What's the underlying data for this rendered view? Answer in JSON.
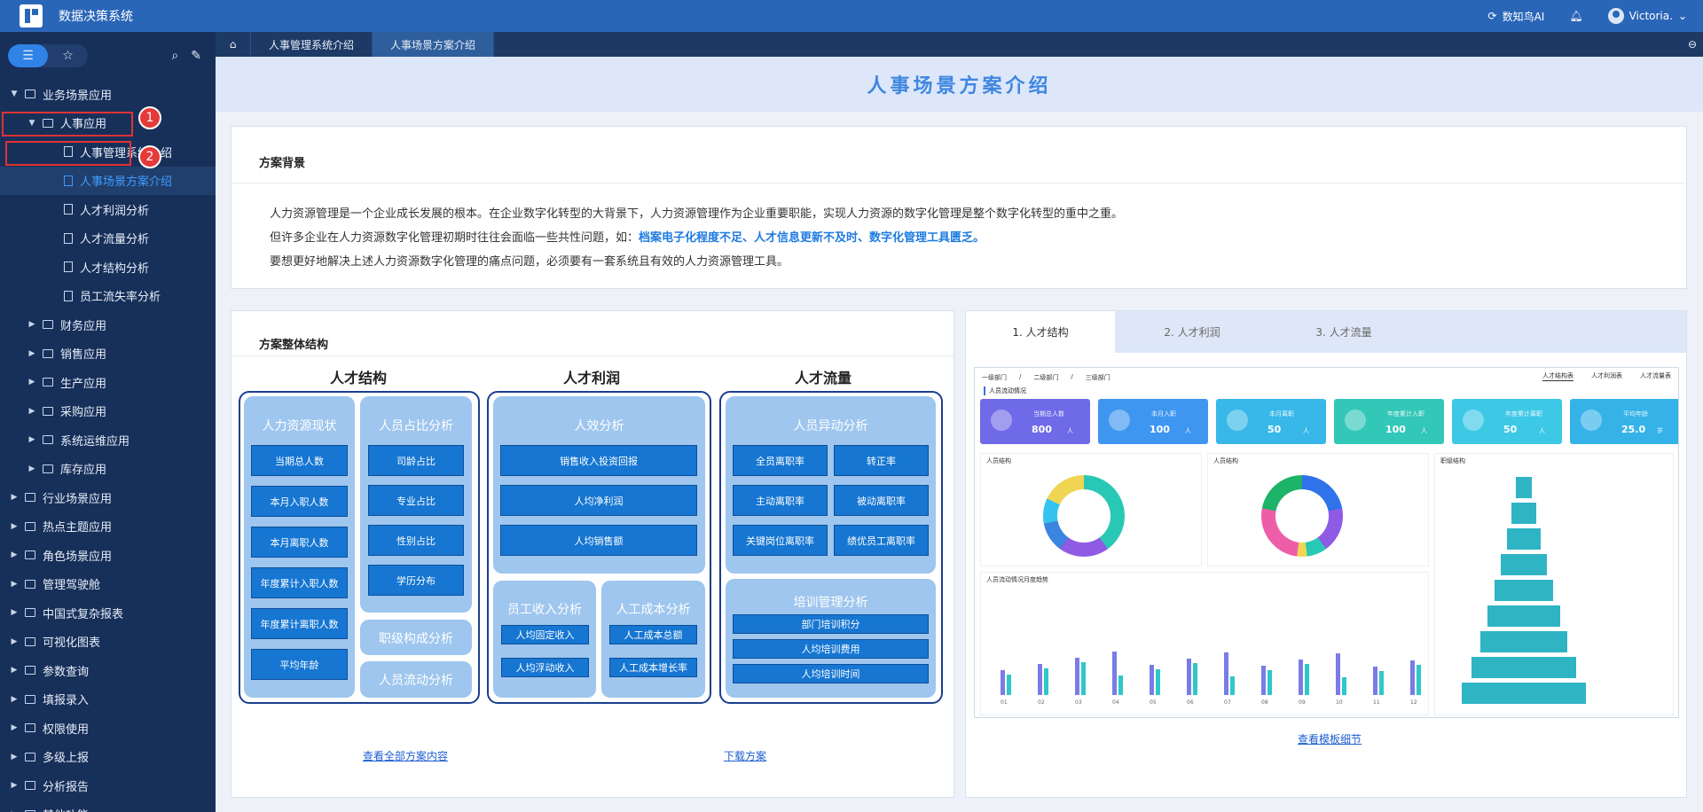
{
  "app": {
    "title": "数据决策系统",
    "ai_label": "数知鸟AI",
    "user": "Victoria."
  },
  "tabs": [
    {
      "label": "人事管理系统介绍"
    },
    {
      "label": "人事场景方案介绍"
    }
  ],
  "sidebar": {
    "items": [
      {
        "label": "业务场景应用",
        "level": 0,
        "expanded": true
      },
      {
        "label": "人事应用",
        "level": 1,
        "expanded": true
      },
      {
        "label": "人事管理系统介绍",
        "level": 2
      },
      {
        "label": "人事场景方案介绍",
        "level": 2,
        "selected": true
      },
      {
        "label": "人才利润分析",
        "level": 2
      },
      {
        "label": "人才流量分析",
        "level": 2
      },
      {
        "label": "人才结构分析",
        "level": 2
      },
      {
        "label": "员工流失率分析",
        "level": 2
      },
      {
        "label": "财务应用",
        "level": 1
      },
      {
        "label": "销售应用",
        "level": 1
      },
      {
        "label": "生产应用",
        "level": 1
      },
      {
        "label": "采购应用",
        "level": 1
      },
      {
        "label": "系统运维应用",
        "level": 1
      },
      {
        "label": "库存应用",
        "level": 1
      },
      {
        "label": "行业场景应用",
        "level": 0
      },
      {
        "label": "热点主题应用",
        "level": 0
      },
      {
        "label": "角色场景应用",
        "level": 0
      },
      {
        "label": "管理驾驶舱",
        "level": 0
      },
      {
        "label": "中国式复杂报表",
        "level": 0
      },
      {
        "label": "可视化图表",
        "level": 0
      },
      {
        "label": "参数查询",
        "level": 0
      },
      {
        "label": "填报录入",
        "level": 0
      },
      {
        "label": "权限使用",
        "level": 0
      },
      {
        "label": "多级上报",
        "level": 0
      },
      {
        "label": "分析报告",
        "level": 0
      },
      {
        "label": "其他功能",
        "level": 0
      }
    ],
    "annotations": [
      "1",
      "2"
    ]
  },
  "page": {
    "title": "人事场景方案介绍",
    "background": {
      "title": "方案背景",
      "line1": "人力资源管理是一个企业成长发展的根本。在企业数字化转型的大背景下，人力资源管理作为企业重要职能，实现人力资源的数字化管理是整个数字化转型的重中之重。",
      "line2_pre": "但许多企业在人力资源数字化管理初期时往往会面临一些共性问题，如：",
      "line2_hl": "档案电子化程度不足、人才信息更新不及时、数字化管理工具匮乏",
      "line2_post": "。",
      "line3": "要想更好地解决上述人力资源数字化管理的痛点问题，必须要有一套系统且有效的人力资源管理工具。"
    },
    "structure": {
      "title": "方案整体结构",
      "col1": {
        "title": "人才结构",
        "g1": {
          "title": "人力资源现状",
          "items": [
            "当期总人数",
            "本月入职人数",
            "本月离职人数",
            "年度累计入职人数",
            "年度累计离职人数",
            "平均年龄"
          ]
        },
        "g2": {
          "title": "人员占比分析",
          "items": [
            "司龄占比",
            "专业占比",
            "性别占比",
            "学历分布"
          ]
        },
        "g3": "职级构成分析",
        "g4": "人员流动分析"
      },
      "col2": {
        "title": "人才利润",
        "g1": {
          "title": "人效分析",
          "items": [
            "销售收入投资回报",
            "人均净利润",
            "人均销售额"
          ]
        },
        "g2": {
          "title": "员工收入分析",
          "items": [
            "人均固定收入",
            "人均浮动收入"
          ]
        },
        "g3": {
          "title": "人工成本分析",
          "items": [
            "人工成本总额",
            "人工成本增长率"
          ]
        }
      },
      "col3": {
        "title": "人才流量",
        "g1": {
          "title": "人员异动分析",
          "items": [
            "全员离职率",
            "转正率",
            "主动离职率",
            "被动离职率",
            "关键岗位离职率",
            "绩优员工离职率"
          ]
        },
        "g2": {
          "title": "培训管理分析",
          "items": [
            "部门培训积分",
            "人均培训费用",
            "人均培训时间"
          ]
        }
      },
      "link_all": "查看全部方案内容",
      "link_download": "下载方案"
    },
    "preview": {
      "tabs": [
        "1. 人才结构",
        "2. 人才利润",
        "3. 人才流量"
      ],
      "link": "查看模板细节",
      "breadcrumb": [
        "一级部门",
        "二级部门",
        "三级部门"
      ],
      "top_tabs": [
        "人才结构表",
        "人才利润表",
        "人才流量表"
      ],
      "section1": "人员流动情况",
      "kpis": [
        {
          "label": "当期总人数",
          "value": "800",
          "unit": "人",
          "color": "#6f6ae8"
        },
        {
          "label": "本月入职",
          "value": "100",
          "unit": "人",
          "color": "#3f96f0"
        },
        {
          "label": "本月离职",
          "value": "50",
          "unit": "人",
          "color": "#38b8e8"
        },
        {
          "label": "年度累计入职",
          "value": "100",
          "unit": "人",
          "color": "#33c7b8"
        },
        {
          "label": "年度累计离职",
          "value": "50",
          "unit": "人",
          "color": "#3dc8e6"
        },
        {
          "label": "平均年龄",
          "value": "25.0",
          "unit": "岁",
          "color": "#35b3e8"
        }
      ],
      "panels": {
        "p1": "人员结构",
        "p2": "人员结构",
        "p3": "职级结构",
        "p4": "人员流动情况月度趋势"
      },
      "months": [
        "01",
        "02",
        "03",
        "04",
        "05",
        "06",
        "07",
        "08",
        "09",
        "10",
        "11",
        "12"
      ]
    }
  }
}
